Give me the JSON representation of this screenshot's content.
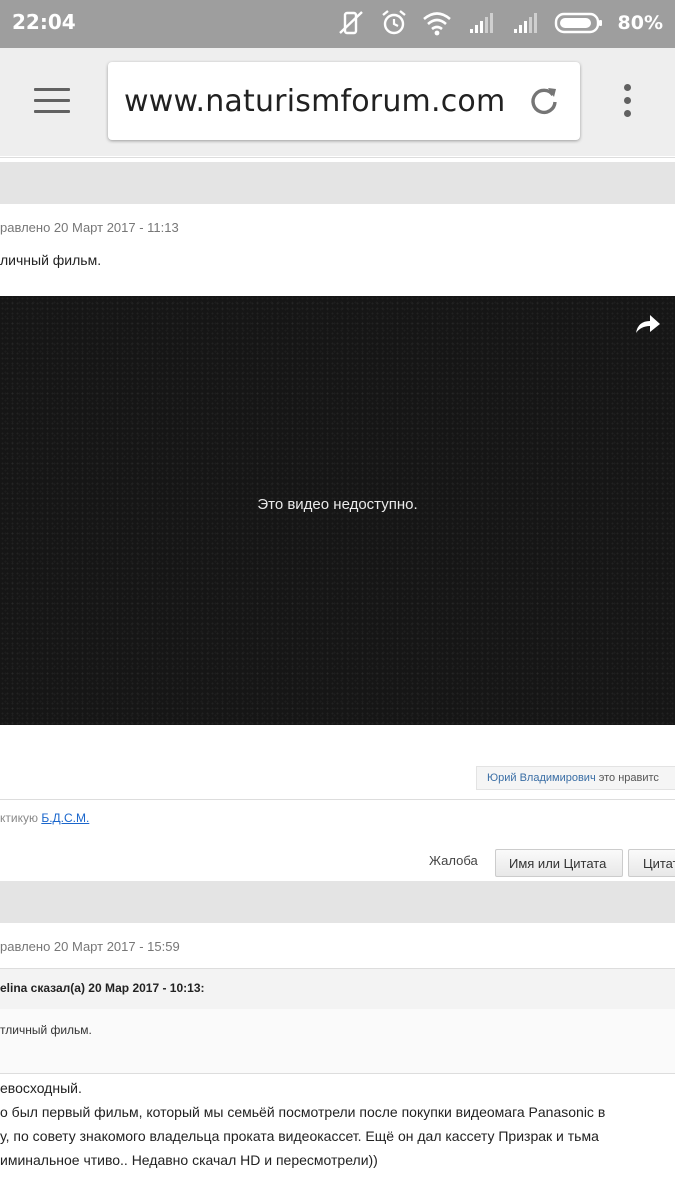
{
  "status_bar": {
    "time": "22:04",
    "battery": "80%",
    "icons": [
      "mute-vibrate-icon",
      "alarm-icon",
      "wifi-icon",
      "signal-icon",
      "signal-icon",
      "battery-icon"
    ]
  },
  "browser": {
    "url": "www.naturismforum.com",
    "icons": [
      "menu-icon",
      "reload-icon",
      "more-vert-icon"
    ]
  },
  "post1": {
    "edited": "равлено 20 Март 2017 - 11:13",
    "text": "личный фильм.",
    "video_message": "Это видео недоступно.",
    "like_name": "Юрий Владимирович",
    "like_suffix": " это нравитс",
    "signature_prefix": "ктикую ",
    "signature_link": "Б.Д.С.М.",
    "actions": {
      "complaint": "Жалоба",
      "quote_name": "Имя или Цитата",
      "quote": "Цитат"
    }
  },
  "post2": {
    "edited": "равлено 20 Март 2017 - 15:59",
    "quote_header": "elina сказал(а) 20 Мар 2017 - 10:13:",
    "quote_text": "тличный фильм.",
    "lines": [
      "евосходный.",
      "о был первый фильм, который мы семьёй посмотрели после покупки видеомага Panasonic в",
      "у, по совету знакомого владельца проката видеокассет.  Ещё он дал кассету Призрак и тьма",
      "иминальное чтиво.. Недавно скачал HD и пересмотрели))"
    ]
  },
  "colors": {
    "status_bar": "#9e9e9e",
    "toolbar": "#eeeeee",
    "video_bg": "#161616",
    "link": "#1a66cc"
  }
}
